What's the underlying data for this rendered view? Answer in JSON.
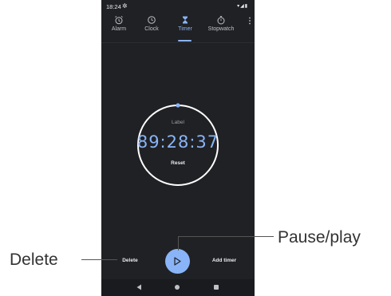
{
  "status_bar": {
    "time": "18:24"
  },
  "tabs": [
    {
      "label": "Alarm",
      "icon": "alarm-icon",
      "active": false
    },
    {
      "label": "Clock",
      "icon": "clock-icon",
      "active": false
    },
    {
      "label": "Timer",
      "icon": "hourglass-icon",
      "active": true
    },
    {
      "label": "Stopwatch",
      "icon": "stopwatch-icon",
      "active": false
    }
  ],
  "timer": {
    "label": "Label",
    "remaining": "89:28:37",
    "reset_label": "Reset"
  },
  "actions": {
    "delete_label": "Delete",
    "add_timer_label": "Add timer"
  },
  "callouts": {
    "pause_play": "Pause/play",
    "delete": "Delete"
  },
  "colors": {
    "background": "#202124",
    "accent": "#8ab4f8",
    "text": "#e8eaed"
  }
}
